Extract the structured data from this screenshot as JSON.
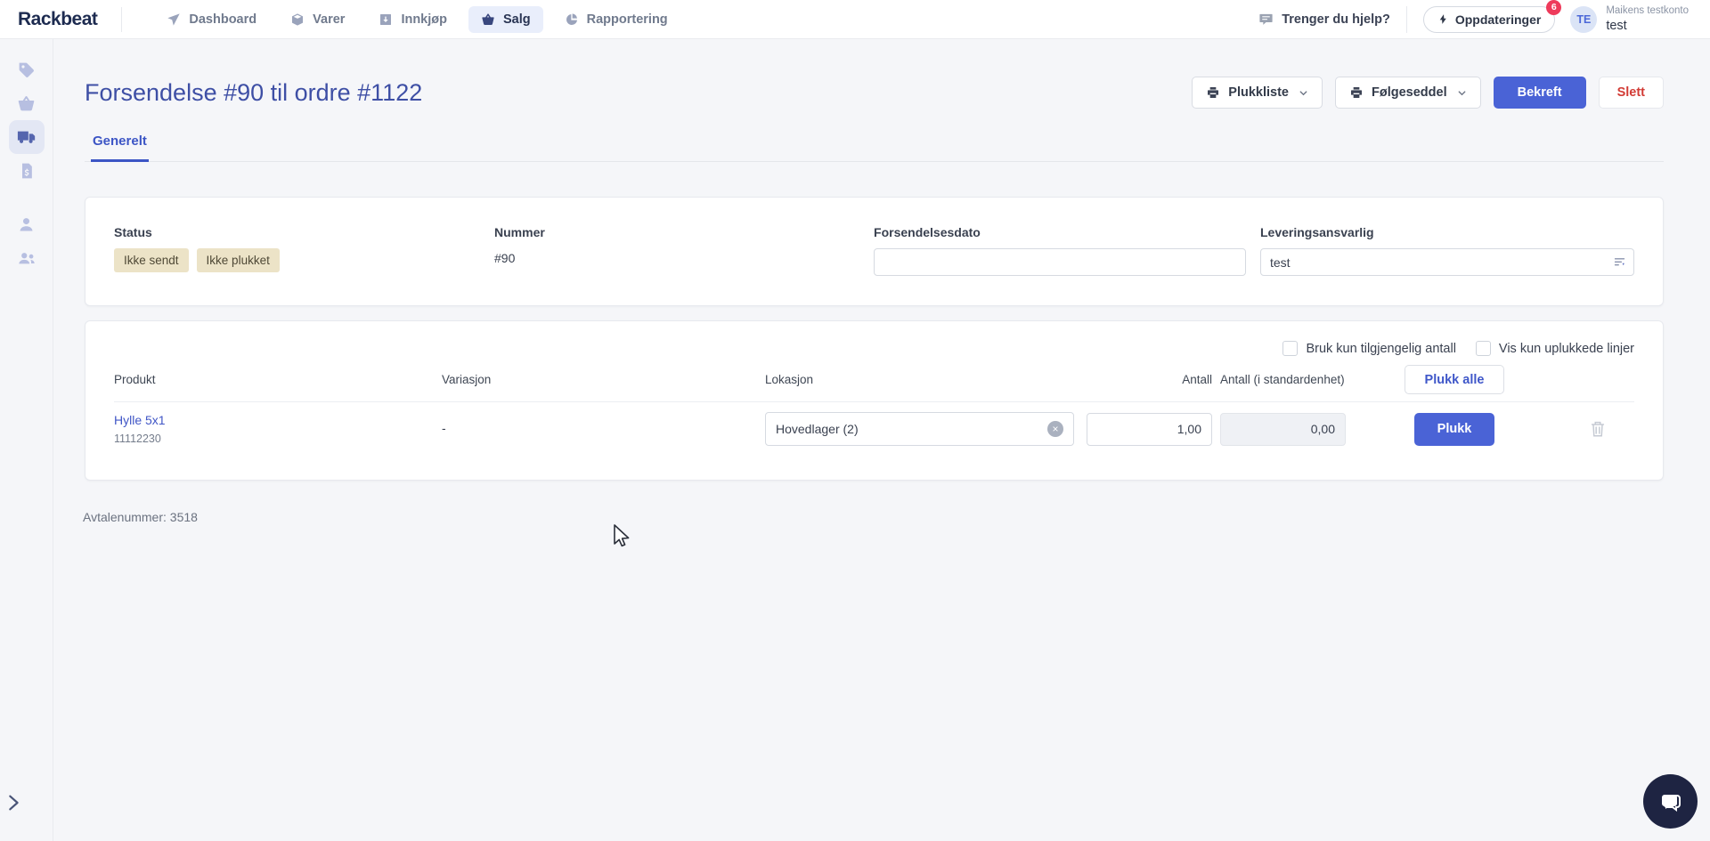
{
  "topnav": {
    "brand": "Rackbeat",
    "items": [
      {
        "label": "Dashboard",
        "icon": "send-icon"
      },
      {
        "label": "Varer",
        "icon": "box-icon"
      },
      {
        "label": "Innkjøp",
        "icon": "purchase-icon"
      },
      {
        "label": "Salg",
        "icon": "basket-icon"
      },
      {
        "label": "Rapportering",
        "icon": "pie-chart-icon"
      }
    ],
    "help_label": "Trenger du hjelp?",
    "updates": {
      "label": "Oppdateringer",
      "count": "6"
    },
    "account": {
      "initials": "TE",
      "company": "Maikens testkonto",
      "user": "test"
    }
  },
  "sidebar": {
    "icons": [
      "tag-icon",
      "basket-icon",
      "truck-icon",
      "invoice-icon",
      "person-icon",
      "users-icon"
    ],
    "active_icon": "truck-icon"
  },
  "page": {
    "title": "Forsendelse #90 til ordre #1122",
    "tab_general": "Generelt",
    "footer_note": "Avtalenummer: 3518"
  },
  "actions": {
    "picklist": "Plukkliste",
    "packing_slip": "Følgeseddel",
    "confirm": "Bekreft",
    "delete": "Slett"
  },
  "details": {
    "status": {
      "label": "Status",
      "badges": [
        "Ikke sendt",
        "Ikke plukket"
      ]
    },
    "number": {
      "label": "Nummer",
      "value": "#90"
    },
    "ship_date": {
      "label": "Forsendelsesdato",
      "value": ""
    },
    "delivery_responsible": {
      "label": "Leveringsansvarlig",
      "value": "test"
    }
  },
  "lines": {
    "options": [
      {
        "label": "Bruk kun tilgjengelig antall",
        "checked": false
      },
      {
        "label": "Vis kun uplukkede linjer",
        "checked": false
      }
    ],
    "headers": {
      "product": "Produkt",
      "variation": "Variasjon",
      "location": "Lokasjon",
      "qty": "Antall",
      "qty_std": "Antall (i standardenhet)"
    },
    "pick_all_label": "Plukk alle",
    "rows": [
      {
        "product": "Hylle 5x1",
        "sku": "11112230",
        "variation": "-",
        "location": "Hovedlager (2)",
        "qty": "1,00",
        "qty_std": "0,00",
        "pick_label": "Plukk"
      }
    ]
  },
  "colors": {
    "primary": "#4a63d6",
    "title": "#3e4fa5",
    "link": "#4056c6",
    "danger": "#d23b35",
    "badge_bg": "#ece3c7",
    "notification": "#ee3b5b",
    "page_bg": "#f5f6f9"
  }
}
